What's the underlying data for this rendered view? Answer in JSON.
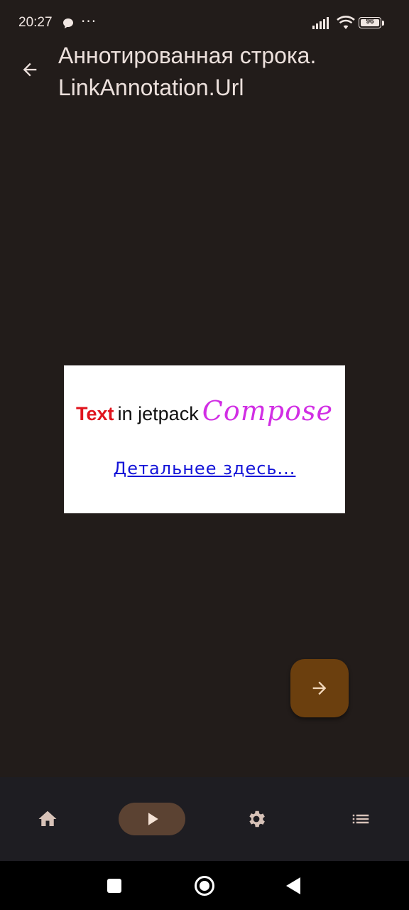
{
  "status_bar": {
    "time": "20:27",
    "overflow": "···",
    "battery_level": "96",
    "icons": [
      "chat-bubble-icon",
      "signal-icon",
      "wifi-icon",
      "battery-icon"
    ]
  },
  "top_bar": {
    "title": "Аннотированная строка. LinkAnnotation.Url",
    "back_icon": "arrow-back-icon"
  },
  "card": {
    "word_text": "Text",
    "word_in": "in jetpack",
    "word_compose": "Compose",
    "link_label": "Детальнее здесь..."
  },
  "fab": {
    "icon": "arrow-forward-icon"
  },
  "bottom_nav": {
    "items": [
      {
        "icon": "home-icon",
        "selected": false
      },
      {
        "icon": "play-icon",
        "selected": true
      },
      {
        "icon": "settings-icon",
        "selected": false
      },
      {
        "icon": "list-icon",
        "selected": false
      }
    ]
  },
  "system_nav": [
    "recents-icon",
    "home-circle-icon",
    "back-triangle-icon"
  ],
  "colors": {
    "background": "#221c1a",
    "card": "#ffffff",
    "text_red": "#e0141d",
    "compose_magenta": "#d12ee4",
    "link_blue": "#1414d8",
    "fab": "#6b3f0e",
    "nav_bar": "#1e1d22",
    "nav_pill": "#5b4232"
  }
}
